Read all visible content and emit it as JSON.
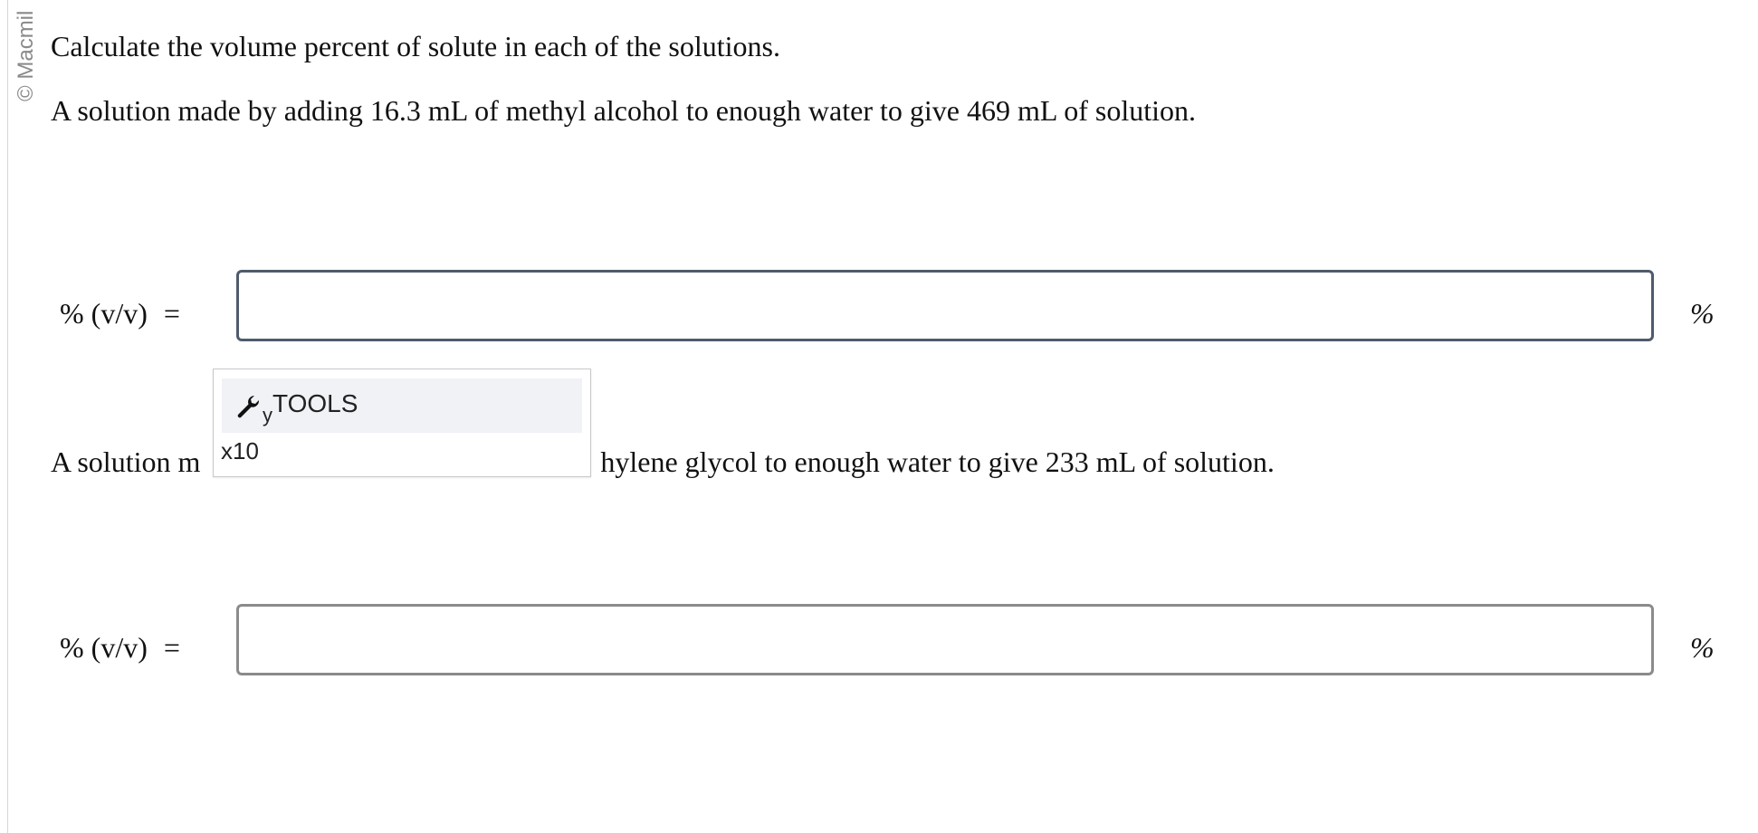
{
  "sidebar": {
    "copyright": "© Macmil"
  },
  "question": {
    "intro": "Calculate the volume percent of solute in each of the solutions.",
    "part1": "A solution made by adding 16.3 mL of methyl alcohol to enough water to give 469 mL of solution.",
    "part2_visible_start": "A solution m",
    "part2_visible_end": "hylene glycol to enough water to give 233 mL of solution."
  },
  "answers": [
    {
      "label": "% (v/v)",
      "equals": "=",
      "value": "",
      "unit": "%"
    },
    {
      "label": "% (v/v)",
      "equals": "=",
      "value": "",
      "unit": "%"
    }
  ],
  "tools_popup": {
    "tools_label": "TOOLS",
    "tools_subscript": "y",
    "x10_label": "x10",
    "icon": "wrench-icon"
  }
}
